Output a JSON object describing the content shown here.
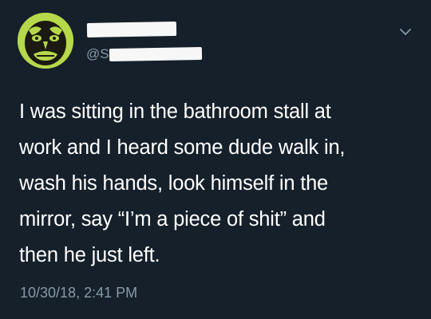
{
  "tweet": {
    "handle_prefix": "@S",
    "text": "I was sitting in the bathroom stall at\nwork and I heard some dude walk in,\nwash his hands, look himself in the\nmirror, say “I’m a piece of shit” and\nthen he just left.",
    "timestamp": "10/30/18, 2:41 PM",
    "menu_icon": "chevron-down-icon"
  },
  "colors": {
    "background": "#15202b",
    "text": "#ffffff",
    "secondary_text": "#8899a6",
    "avatar_green": "#b6d84a"
  }
}
